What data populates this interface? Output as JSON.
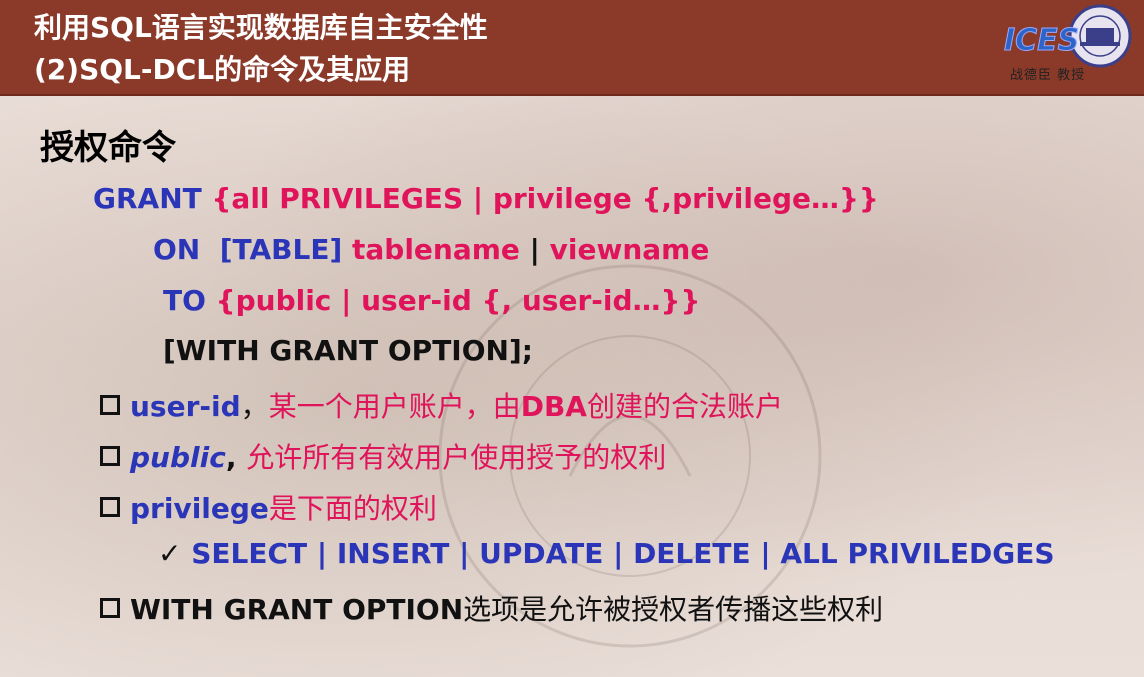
{
  "header": {
    "title_line1": "利用SQL语言实现数据库自主安全性",
    "title_line2": "(2)SQL-DCL的命令及其应用",
    "logo_text": "ICES",
    "logo_caption": "战德臣 教授"
  },
  "body": {
    "heading": "授权命令",
    "grant": {
      "kw_grant": "GRANT",
      "privs": "{all PRIVILEGES | privilege {,privilege…}}",
      "kw_on": "ON",
      "table_opt": "[TABLE]",
      "tablename": "tablename",
      "sep": "|",
      "viewname": "viewname",
      "kw_to": "TO",
      "to_list": "{public | user-id {, user-id…}}",
      "with_option": "[WITH GRANT OPTION];"
    },
    "bullets": {
      "b1_term": "user-id",
      "b1_comma": "，",
      "b1_desc1": "某一个用户账户，由",
      "b1_dba": "DBA",
      "b1_desc2": "创建的合法账户",
      "b2_term": "public",
      "b2_comma": ",",
      "b2_desc": "允许所有有效用户使用授予的权利",
      "b3_term": "privilege",
      "b3_desc": "是下面的权利",
      "check_mark": "✓",
      "privileges_list": "SELECT | INSERT | UPDATE | DELETE | ALL PRIVILEDGES",
      "b4_term": "WITH GRANT OPTION",
      "b4_desc": "选项是允许被授权者传播这些权利"
    }
  },
  "colors": {
    "header_bg": "#8b3a2a",
    "keyword_blue": "#2b35b8",
    "accent_pink": "#e0145a"
  }
}
